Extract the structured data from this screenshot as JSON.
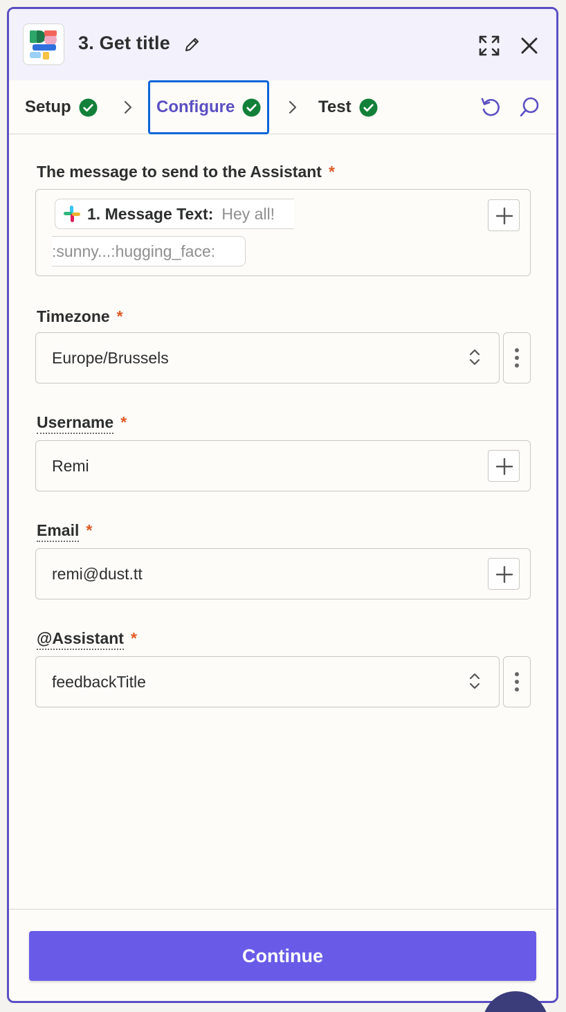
{
  "header": {
    "title": "3. Get title",
    "icons": {
      "app": "app-logo-icon",
      "edit": "pencil-icon",
      "expand": "expand-icon",
      "close": "close-icon"
    }
  },
  "tabs": [
    {
      "label": "Setup",
      "status": "complete",
      "active": false
    },
    {
      "label": "Configure",
      "status": "complete",
      "active": true
    },
    {
      "label": "Test",
      "status": "complete",
      "active": false
    }
  ],
  "toolbar_icons": [
    "undo-icon",
    "search-icon"
  ],
  "colors": {
    "accent": "#5b4fc3",
    "primary_button": "#695be8",
    "success": "#13803a",
    "required": "#e05a24",
    "focus": "#0b65d8"
  },
  "form": {
    "message": {
      "label": "The message to send to the Assistant",
      "required_mark": "*",
      "chip_label": "1. Message Text:",
      "chip_value": "Hey all!",
      "chip_value_cont": ":sunny...:hugging_face:"
    },
    "timezone": {
      "label": "Timezone",
      "required_mark": "*",
      "value": "Europe/Brussels"
    },
    "username": {
      "label": "Username",
      "required_mark": "*",
      "value": "Remi"
    },
    "email": {
      "label": "Email",
      "required_mark": "*",
      "value": "remi@dust.tt"
    },
    "assistant": {
      "label": "@Assistant",
      "required_mark": "*",
      "value": "feedbackTitle"
    }
  },
  "footer": {
    "continue_label": "Continue"
  }
}
